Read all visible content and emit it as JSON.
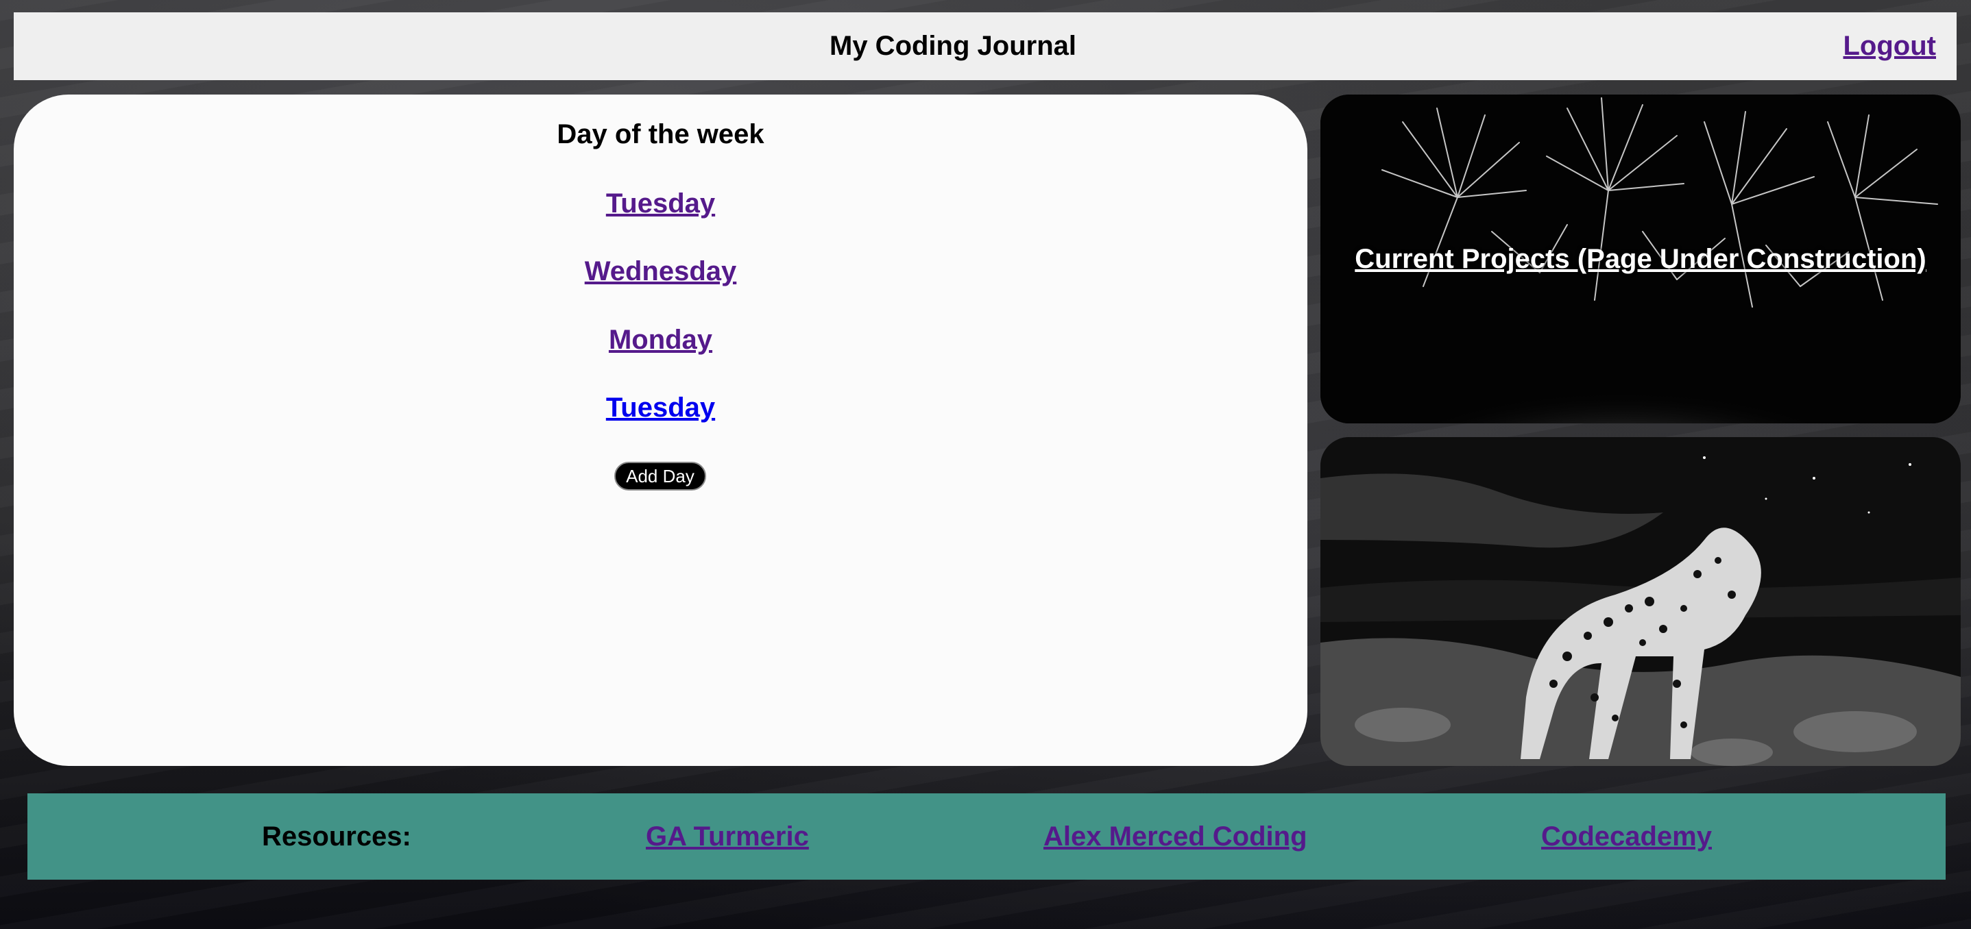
{
  "header": {
    "title": "My Coding Journal",
    "logout_label": "Logout"
  },
  "journal": {
    "heading": "Day of the week",
    "days": [
      {
        "label": "Tuesday",
        "visited": true
      },
      {
        "label": "Wednesday",
        "visited": true
      },
      {
        "label": "Monday",
        "visited": true
      },
      {
        "label": "Tuesday",
        "visited": false
      }
    ],
    "add_day_label": "Add Day"
  },
  "sidebar": {
    "projects_label": "Current Projects (Page Under Construction)",
    "projects_image": "fireworks-photo",
    "second_image": "leopard-photo"
  },
  "footer": {
    "label": "Resources:",
    "links": [
      "GA Turmeric",
      "Alex Merced Coding",
      "Codecademy"
    ]
  },
  "colors": {
    "header_bg": "#efefef",
    "footer_bg": "#429387",
    "visited_link": "#551a8b",
    "unvisited_link": "#0000ee",
    "card_bg": "#fbfbfb",
    "button_bg": "#000000"
  }
}
